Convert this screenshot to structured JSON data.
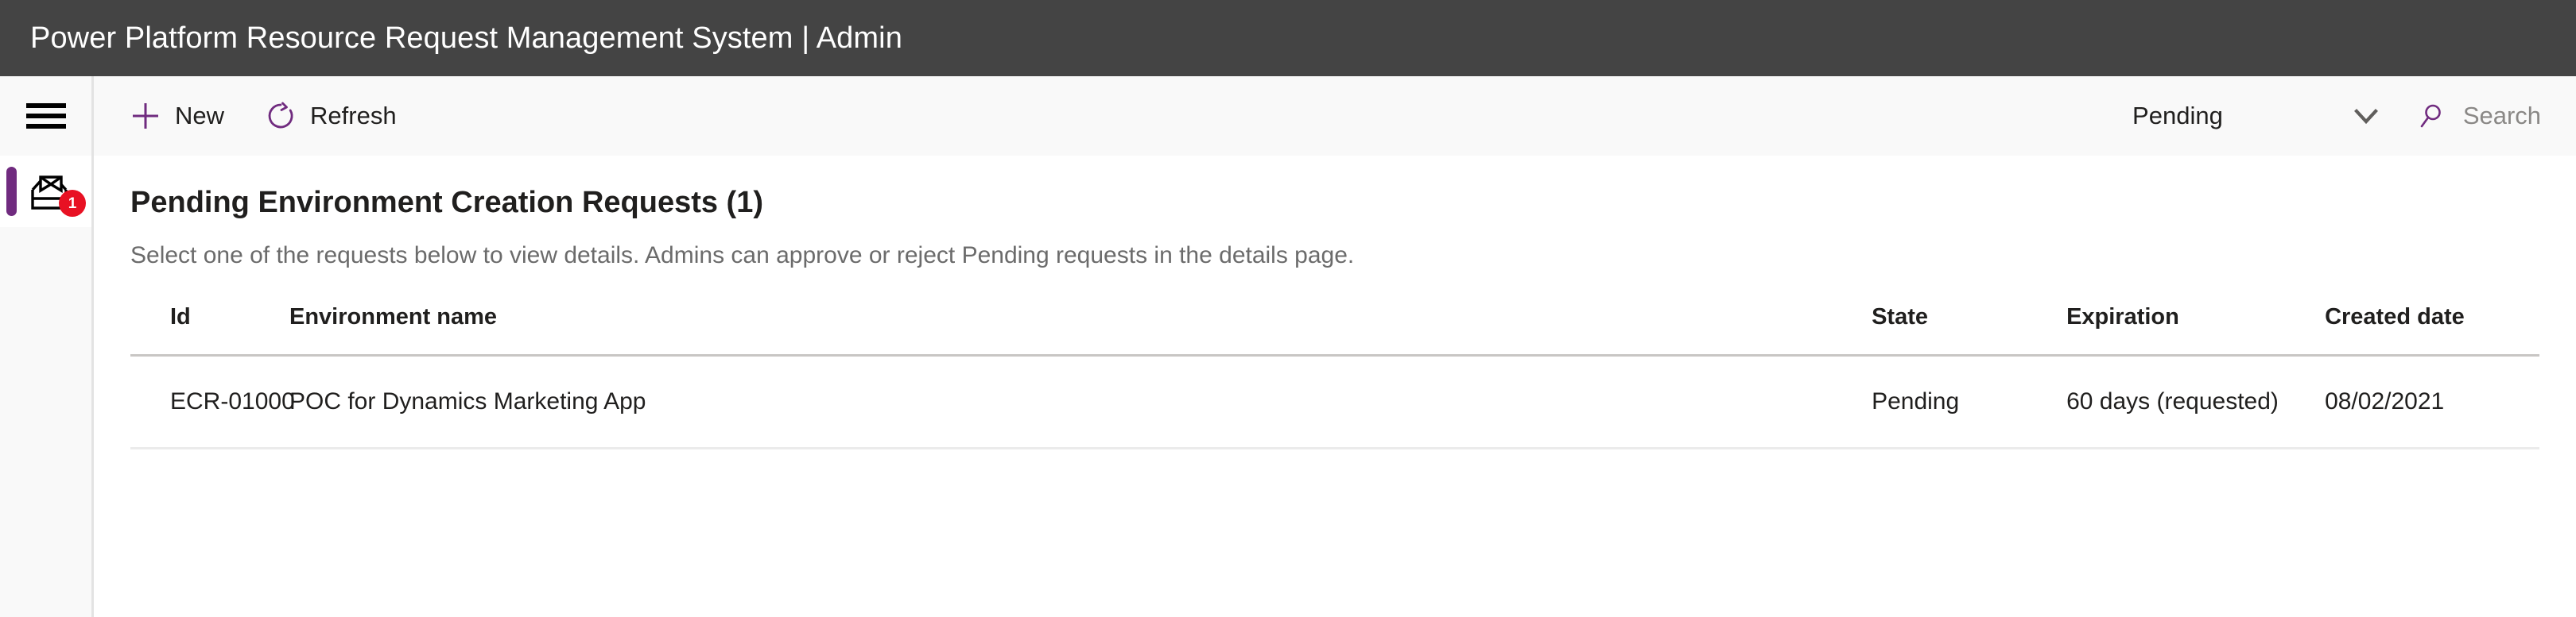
{
  "window": {
    "title": "Power Platform Resource Request Management System | Admin",
    "titlebar_bg": "#444444"
  },
  "rail": {
    "menu_icon": "hamburger-icon",
    "items": [
      {
        "icon": "inbox-tray-icon",
        "badge": "1",
        "badge_color": "#e81123",
        "active": true,
        "accent_color": "#702b7f"
      }
    ]
  },
  "toolbar": {
    "new_label": "New",
    "new_icon": "plus-icon",
    "refresh_label": "Refresh",
    "refresh_icon": "refresh-circle-arrow-icon",
    "accent_color": "#702b7f",
    "filter_value": "Pending",
    "filter_chevron_icon": "chevron-down-icon",
    "search_icon": "search-magnifier-icon",
    "search_value": "",
    "search_placeholder": "Search"
  },
  "page": {
    "title": "Pending Environment Creation Requests (1)",
    "description": "Select one of the requests below to view details. Admins can approve or reject Pending requests in the details page."
  },
  "table": {
    "columns": [
      {
        "key": "id",
        "label": "Id"
      },
      {
        "key": "environment_name",
        "label": "Environment name"
      },
      {
        "key": "state",
        "label": "State"
      },
      {
        "key": "expiration",
        "label": "Expiration"
      },
      {
        "key": "created_date",
        "label": "Created date"
      }
    ],
    "rows": [
      {
        "id": "ECR-01000",
        "environment_name": "POC for Dynamics Marketing App",
        "state": "Pending",
        "expiration": "60 days (requested)",
        "created_date": "08/02/2021"
      }
    ]
  }
}
